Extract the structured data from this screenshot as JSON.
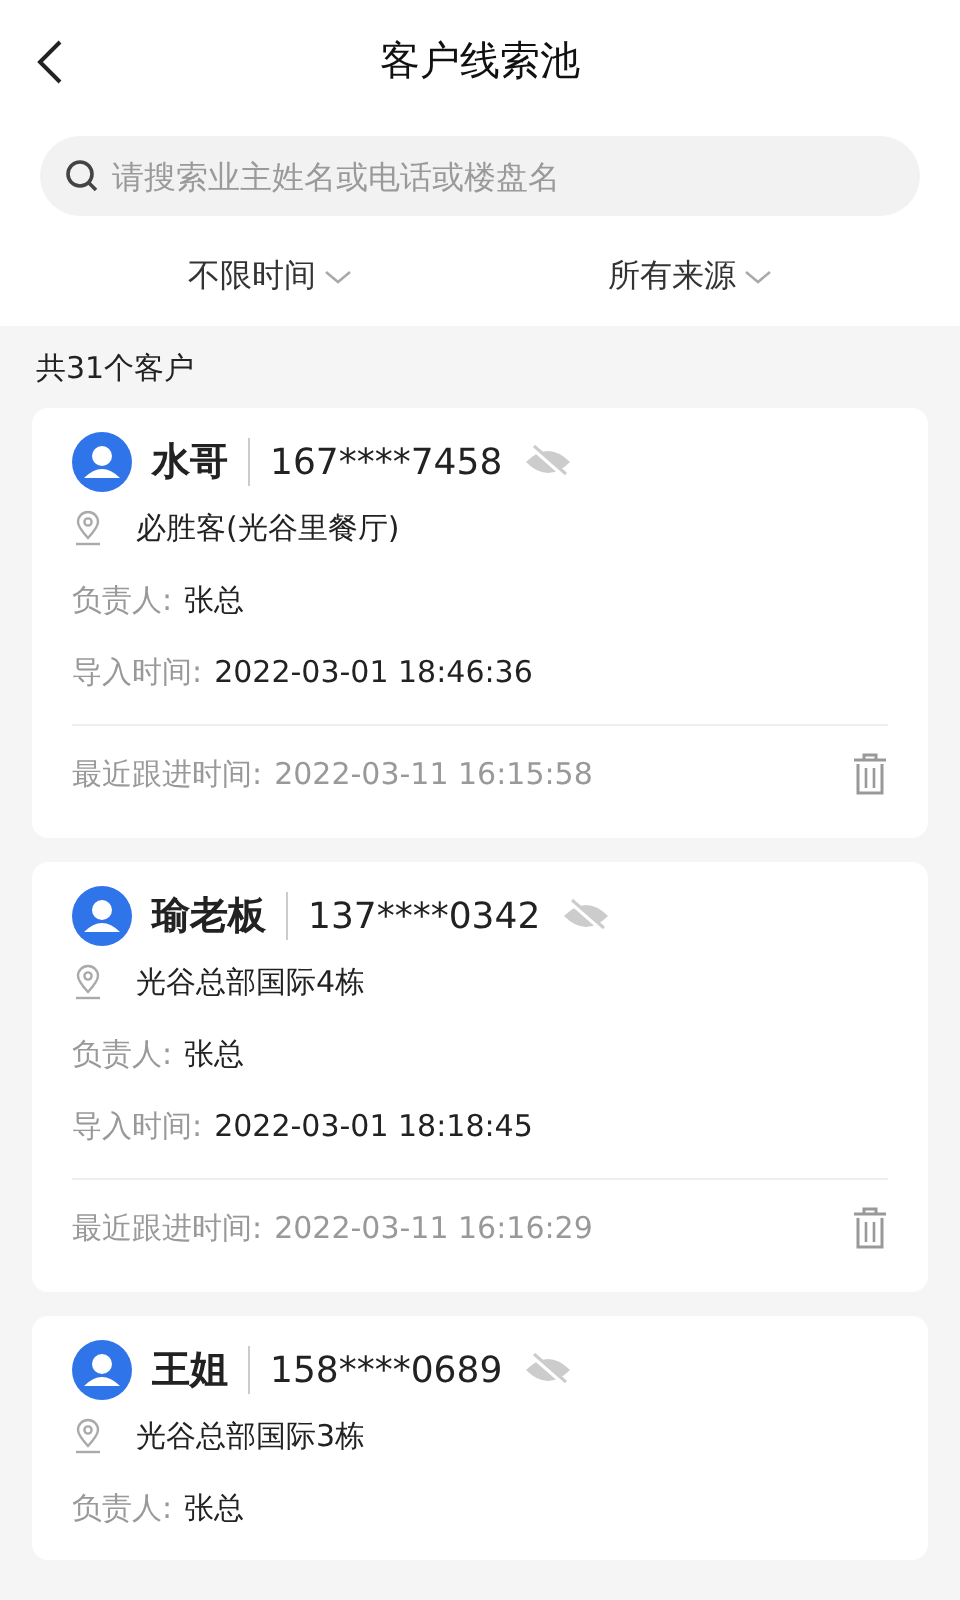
{
  "header": {
    "title": "客户线索池"
  },
  "search": {
    "placeholder": "请搜索业主姓名或电话或楼盘名"
  },
  "filters": [
    {
      "label": "不限时间"
    },
    {
      "label": "所有来源"
    }
  ],
  "count": "共31个客户",
  "customers": [
    {
      "name": "水哥",
      "phone": "167****7458",
      "address": "必胜客(光谷里餐厅)",
      "owner_label": "负责人:",
      "owner": "张总",
      "import_label": "导入时间:",
      "import_time": "2022-03-01 18:46:36",
      "follow_label": "最近跟进时间:",
      "follow_time": "2022-03-11 16:15:58"
    },
    {
      "name": "瑜老板",
      "phone": "137****0342",
      "address": "光谷总部国际4栋",
      "owner_label": "负责人:",
      "owner": "张总",
      "import_label": "导入时间:",
      "import_time": "2022-03-01 18:18:45",
      "follow_label": "最近跟进时间:",
      "follow_time": "2022-03-11 16:16:29"
    },
    {
      "name": "王姐",
      "phone": "158****0689",
      "address": "光谷总部国际3栋",
      "owner_label": "负责人:",
      "owner": "张总"
    }
  ]
}
